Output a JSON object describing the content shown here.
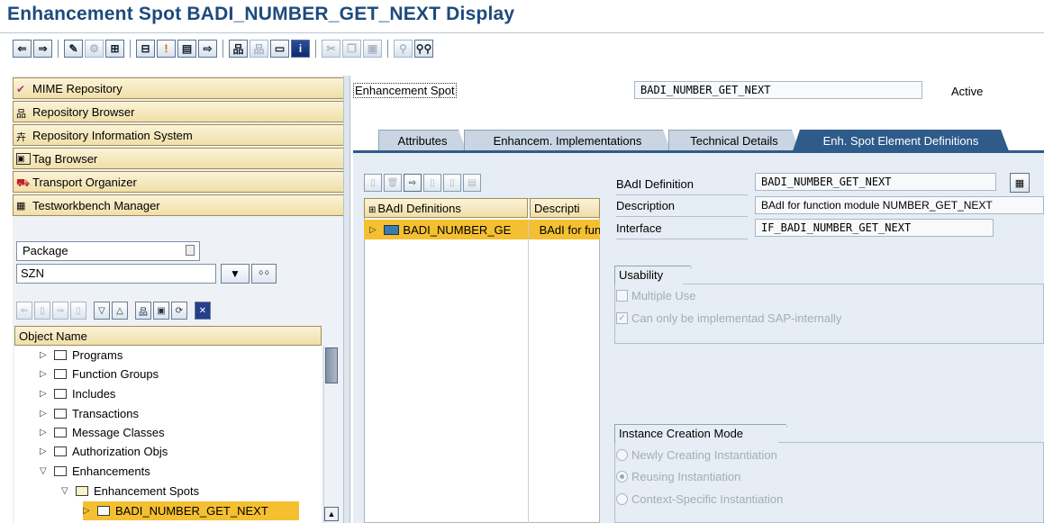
{
  "window": {
    "title": "Enhancement Spot BADI_NUMBER_GET_NEXT Display"
  },
  "toolbar": {
    "icons": [
      "back-icon",
      "forward-icon",
      "other-object-icon",
      "display-change-icon",
      "activate-icon",
      "where-used-icon",
      "object-list-icon",
      "navigation-window-icon",
      "display-object-list-icon",
      "hierarchy-icon",
      "enhance-icon",
      "settings-icon",
      "info-icon",
      "cut-icon",
      "copy-icon",
      "paste-icon",
      "find-icon",
      "find-next-icon"
    ]
  },
  "nav": {
    "buttons": [
      {
        "label": "MIME Repository",
        "icon": "mime-icon"
      },
      {
        "label": "Repository Browser",
        "icon": "repository-icon"
      },
      {
        "label": "Repository Information System",
        "icon": "info-system-icon"
      },
      {
        "label": "Tag Browser",
        "icon": "tag-icon"
      },
      {
        "label": "Transport Organizer",
        "icon": "truck-icon"
      },
      {
        "label": "Testworkbench Manager",
        "icon": "testbench-icon"
      }
    ],
    "object_type": "Package",
    "object_value": "SZN",
    "tree_header": "Object Name",
    "tree": [
      {
        "label": "Programs",
        "level": 1,
        "expanded": false
      },
      {
        "label": "Function Groups",
        "level": 1,
        "expanded": false
      },
      {
        "label": "Includes",
        "level": 1,
        "expanded": false
      },
      {
        "label": "Transactions",
        "level": 1,
        "expanded": false
      },
      {
        "label": "Message Classes",
        "level": 1,
        "expanded": false
      },
      {
        "label": "Authorization Objs",
        "level": 1,
        "expanded": false
      },
      {
        "label": "Enhancements",
        "level": 1,
        "expanded": true
      },
      {
        "label": "Enhancement Spots",
        "level": 2,
        "expanded": true
      },
      {
        "label": "BADI_NUMBER_GET_NEXT",
        "level": 3,
        "expanded": false,
        "selected": true
      }
    ]
  },
  "main": {
    "spot_label": "Enhancement Spot",
    "spot_value": "BADI_NUMBER_GET_NEXT",
    "status": "Active",
    "tabs": [
      {
        "label": "Attributes",
        "active": false
      },
      {
        "label": "Enhancem. Implementations",
        "active": false
      },
      {
        "label": "Technical Details",
        "active": false
      },
      {
        "label": "Enh. Spot Element Definitions",
        "active": true
      }
    ],
    "badi_table": {
      "col1": "BAdI Definitions",
      "col2": "Descripti",
      "row_name": "BADI_NUMBER_GE",
      "row_desc": "BAdI for fun"
    },
    "fields": {
      "definition_label": "BAdI Definition",
      "definition_value": "BADI_NUMBER_GET_NEXT",
      "description_label": "Description",
      "description_value": "BAdI for function module NUMBER_GET_NEXT",
      "interface_label": "Interface",
      "interface_value": "IF_BADI_NUMBER_GET_NEXT"
    },
    "usability": {
      "title": "Usability",
      "multiple_use": "Multiple Use",
      "multiple_use_checked": false,
      "sap_internal": "Can only be implementad SAP-internally",
      "sap_internal_checked": true
    },
    "instance": {
      "title": "Instance Creation Mode",
      "options": [
        {
          "label": "Newly Creating Instantiation",
          "selected": false
        },
        {
          "label": "Reusing Instantiation",
          "selected": true
        },
        {
          "label": "Context-Specific Instantiation",
          "selected": false
        }
      ]
    }
  },
  "colors": {
    "title": "#1d4a7c",
    "active_tab": "#2e5b8a",
    "selection": "#f4c031",
    "header_bg": "#f0dfa8"
  }
}
